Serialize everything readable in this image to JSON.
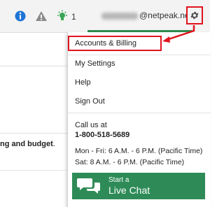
{
  "header": {
    "info_icon": "info-circle-icon",
    "warning_icon": "warning-triangle-icon",
    "bulb_icon": "lightbulb-icon",
    "notification_count": "1",
    "user_email_domain": "@netpeak.net",
    "settings_icon": "gear-icon"
  },
  "page": {
    "left_text_bold": "ng and budget",
    "left_text_punct": "."
  },
  "menu": {
    "items": [
      {
        "label": "Accounts & Billing"
      },
      {
        "label": "My Settings"
      },
      {
        "label": "Help"
      },
      {
        "label": "Sign Out"
      }
    ],
    "call_label": "Call us at",
    "phone": "1-800-518-5689",
    "hours": [
      "Mon - Fri: 6 A.M. - 6 P.M. (Pacific Time)",
      "Sat: 8 A.M. - 6 P.M. (Pacific Time)"
    ],
    "chat_small": "Start a",
    "chat_big": "Live Chat",
    "chat_icon": "chat-bubbles-icon"
  },
  "colors": {
    "accent_green": "#2e8b57",
    "annotation_red": "#e0141e",
    "info_blue": "#1f74d6"
  }
}
